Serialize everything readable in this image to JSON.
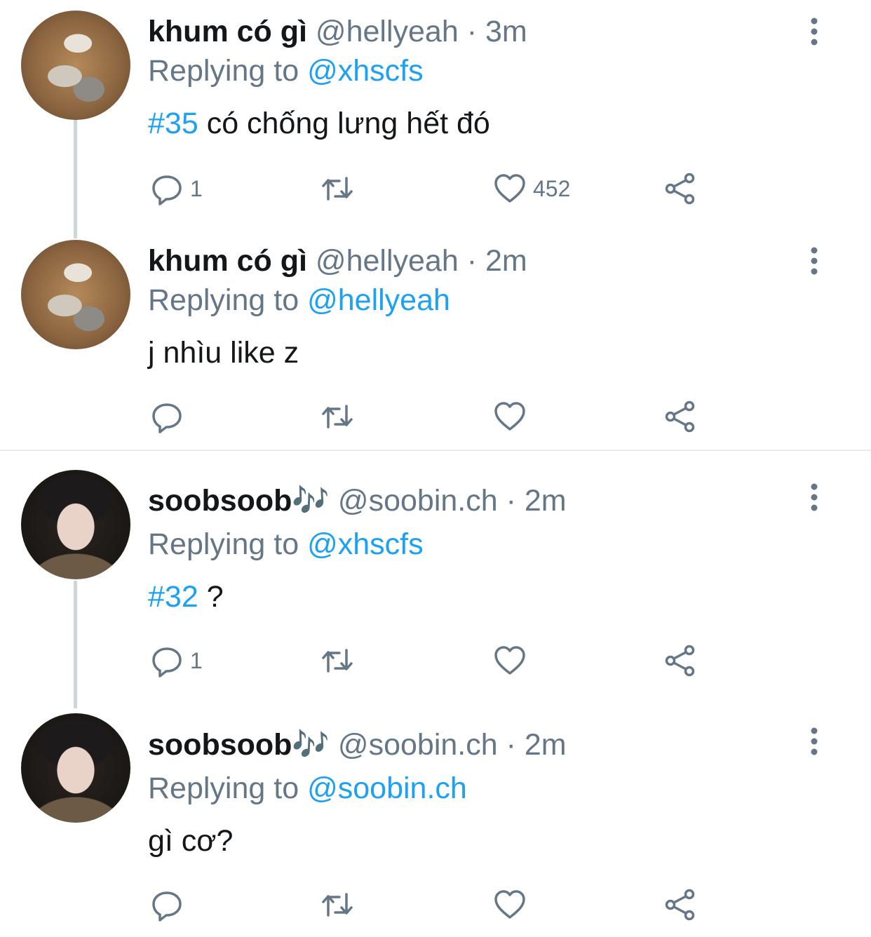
{
  "colors": {
    "accent": "#1da1f2",
    "muted": "#657786",
    "text": "#14171a",
    "thread_line": "#ccd6dd"
  },
  "tweets": [
    {
      "name": "khum có gì",
      "handle": "@hellyeah",
      "separator": "·",
      "time": "3m",
      "replying_prefix": "Replying to",
      "replying_to": "@xhscfs",
      "hashtag": "#35",
      "text": " có chống lưng hết đó",
      "reply_count": "1",
      "like_count": "452",
      "avatar": "cat-photo"
    },
    {
      "name": "khum có gì",
      "handle": "@hellyeah",
      "separator": "·",
      "time": "2m",
      "replying_prefix": "Replying to",
      "replying_to": "@hellyeah",
      "hashtag": "",
      "text": "j nhìu like z",
      "reply_count": "",
      "like_count": "",
      "avatar": "cat-photo"
    },
    {
      "name": "soobsoob🎶",
      "handle": "@soobin.ch",
      "separator": "·",
      "time": "2m",
      "replying_prefix": "Replying to",
      "replying_to": "@xhscfs",
      "hashtag": "#32",
      "text": " ?",
      "reply_count": "1",
      "like_count": "",
      "avatar": "person-photo"
    },
    {
      "name": "soobsoob🎶",
      "handle": "@soobin.ch",
      "separator": "·",
      "time": "2m",
      "replying_prefix": "Replying to",
      "replying_to": "@soobin.ch",
      "hashtag": "",
      "text": "gì cơ?",
      "reply_count": "",
      "like_count": "",
      "avatar": "person-photo"
    }
  ],
  "icons": {
    "reply": "reply-icon",
    "retweet": "retweet-icon",
    "like": "heart-icon",
    "share": "share-icon",
    "more": "more-vertical-icon"
  }
}
